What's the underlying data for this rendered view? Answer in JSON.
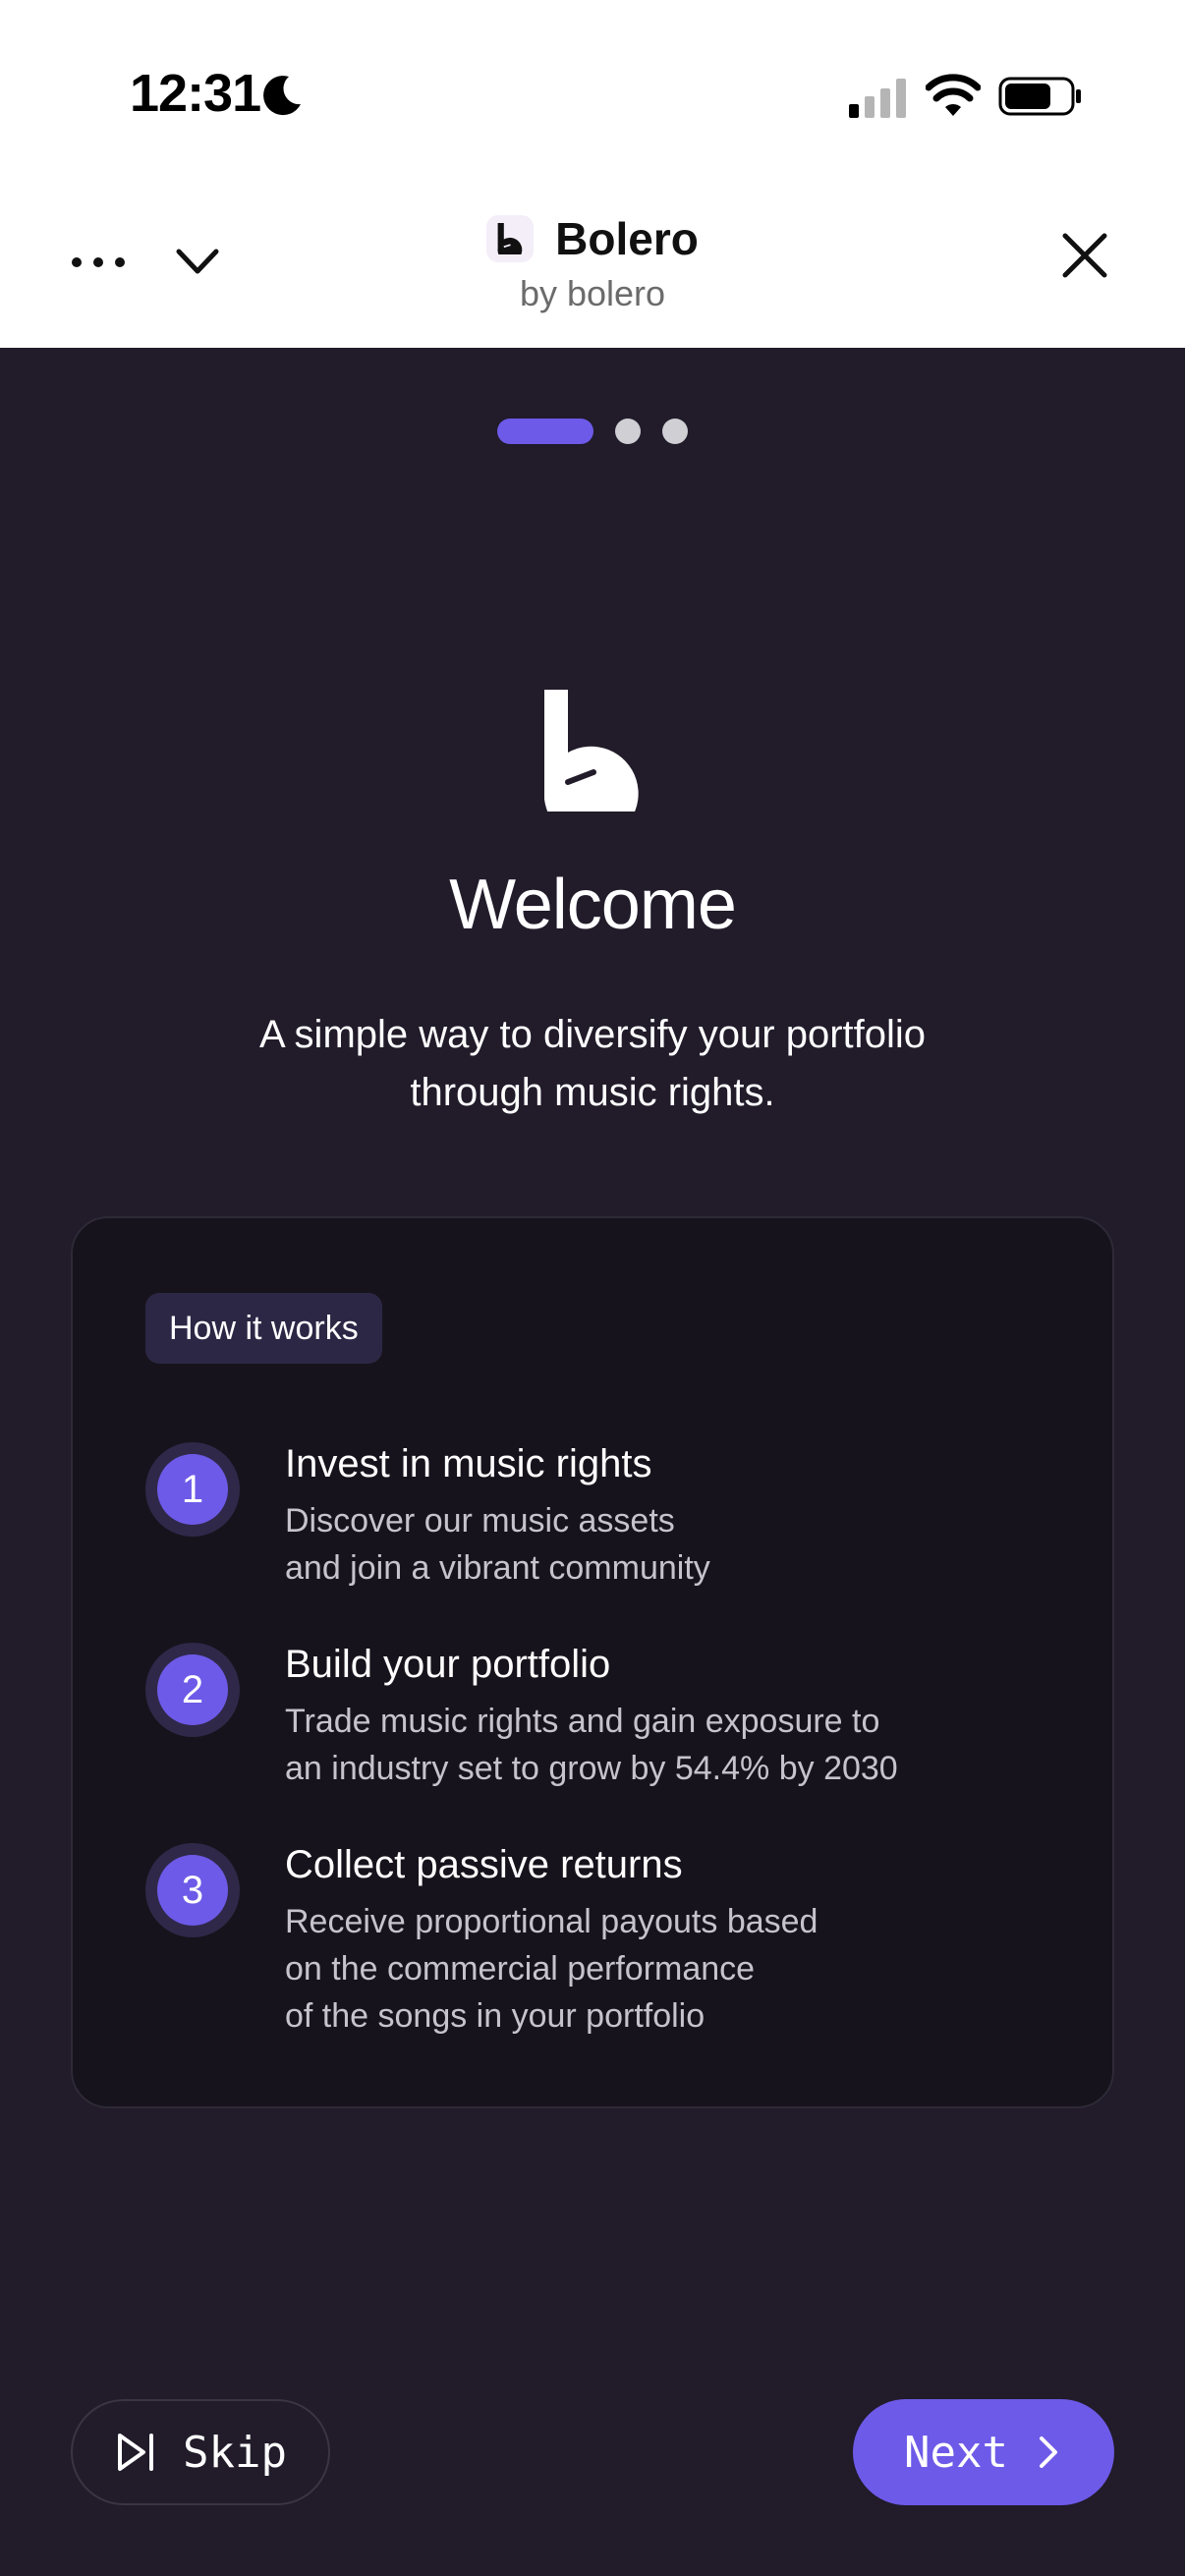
{
  "status_bar": {
    "time": "12:31",
    "icons": [
      "moon-icon",
      "signal-icon",
      "wifi-icon",
      "battery-icon"
    ]
  },
  "header": {
    "title": "Bolero",
    "subtitle": "by bolero",
    "icons": [
      "more-icon",
      "chevron-down-icon",
      "close-icon"
    ]
  },
  "pager": {
    "total": 3,
    "active_index": 0
  },
  "welcome": {
    "title": "Welcome",
    "subtitle": "A simple way to diversify your portfolio through music rights."
  },
  "how_it_works": {
    "badge": "How it works",
    "steps": [
      {
        "number": "1",
        "title": "Invest in music rights",
        "description": "Discover our music assets\nand join a vibrant community"
      },
      {
        "number": "2",
        "title": "Build your portfolio",
        "description": "Trade music rights and gain exposure to\nan industry set to grow by 54.4% by 2030"
      },
      {
        "number": "3",
        "title": "Collect passive returns",
        "description": "Receive proportional payouts based\non the commercial performance\nof the songs in your portfolio"
      }
    ]
  },
  "actions": {
    "skip_label": "Skip",
    "next_label": "Next"
  },
  "colors": {
    "accent": "#6d5ae8",
    "background": "#211b2a",
    "card": "#17131c",
    "header_bg": "#ffffff"
  }
}
